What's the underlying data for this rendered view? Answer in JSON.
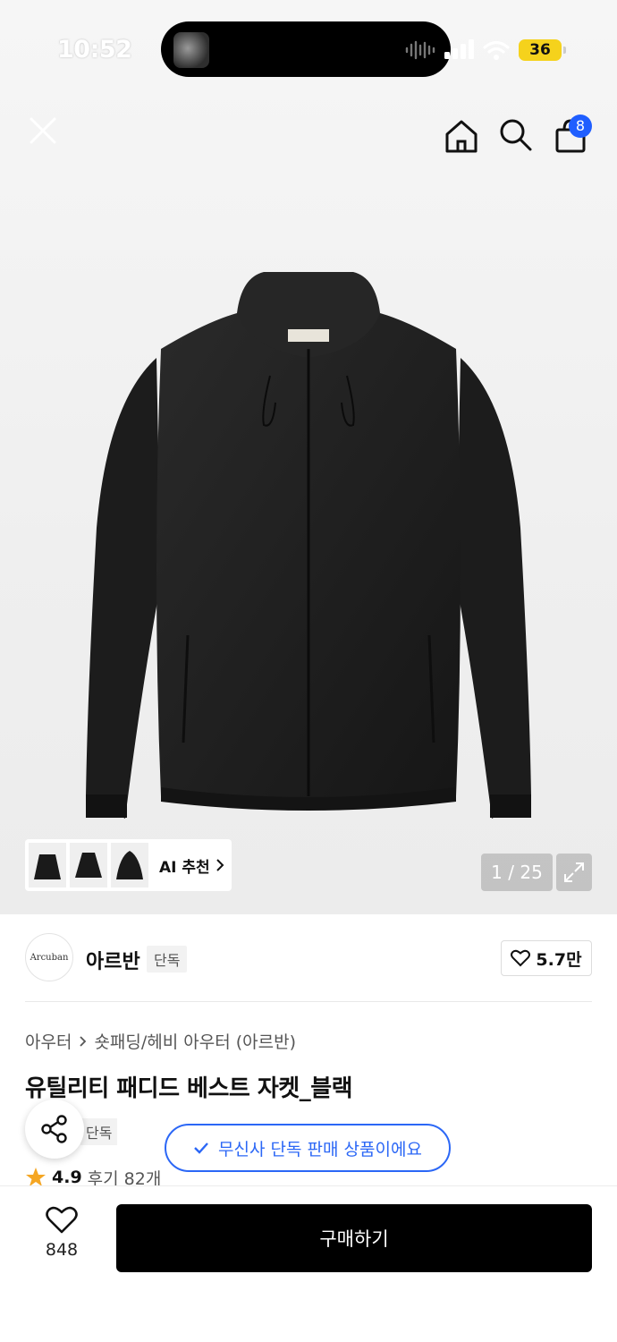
{
  "status_bar": {
    "time": "10:52",
    "battery": "36"
  },
  "header": {
    "cart_count": "8"
  },
  "gallery": {
    "ai_label": "AI 추천",
    "counter": "1 / 25"
  },
  "brand": {
    "logo_text": "Arcuban",
    "name": "아르반",
    "tag": "단독",
    "likes": "5.7만"
  },
  "product": {
    "breadcrumb": [
      "아우터",
      "숏패딩/헤비 아우터 (아르반)"
    ],
    "title": "유틸리티 패디드 베스트 자켓_블랙",
    "sub_tag": "단독",
    "exclusive_toast": "무신사 단독 판매 상품이에요",
    "rating": "4.9",
    "reviews": "후기 82개"
  },
  "bottom_bar": {
    "wish_count": "848",
    "buy_label": "구매하기"
  },
  "colors": {
    "accent": "#2b67f6",
    "badge": "#1f5eff",
    "star": "#f5a623"
  }
}
